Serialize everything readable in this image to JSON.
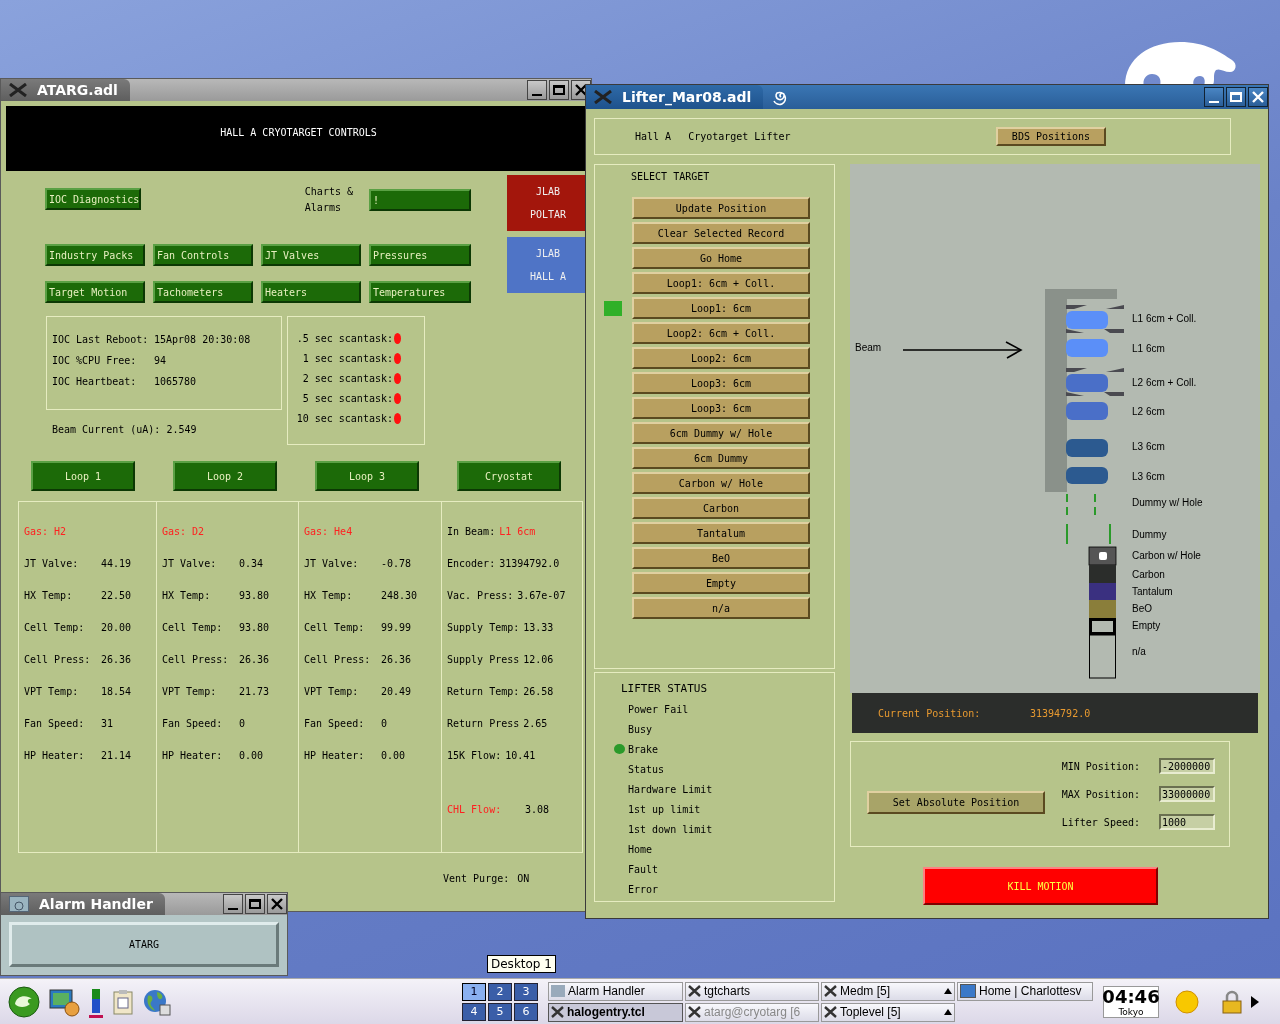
{
  "atarg_window": {
    "title": "ATARG.adl",
    "banner": "HALL A CRYOTARGET CONTROLS",
    "diagnostics_button": "IOC Diagnostics",
    "charts_label": [
      "Charts &",
      "Alarms"
    ],
    "charts_button": "!",
    "site_buttons": [
      {
        "lines": [
          "JLAB",
          "POLTAR"
        ],
        "color": "#a3160c"
      },
      {
        "lines": [
          "JLAB",
          "HALL A"
        ],
        "color": "#4f74c6"
      }
    ],
    "menu_buttons": [
      "Industry Packs",
      "Fan Controls",
      "JT Valves",
      "Pressures",
      "Target Motion",
      "Tachometers",
      "Heaters",
      "Temperatures"
    ],
    "ioc_info": [
      {
        "label": "IOC Last Reboot:",
        "value": "15Apr08 20:30:08"
      },
      {
        "label": "IOC %CPU Free:",
        "value": "94"
      },
      {
        "label": "IOC Heartbeat:",
        "value": "1065780"
      }
    ],
    "beam_current": {
      "label": "Beam Current (uA):",
      "value": "2.549"
    },
    "scantasks": [
      {
        "label": ".5 sec scantask:",
        "alarm": true
      },
      {
        "label": "1 sec scantask:",
        "alarm": true
      },
      {
        "label": "2 sec scantask:",
        "alarm": true
      },
      {
        "label": "5 sec scantask:",
        "alarm": true
      },
      {
        "label": "10 sec scantask:",
        "alarm": true
      }
    ],
    "loop_buttons": [
      "Loop 1",
      "Loop 2",
      "Loop 3",
      "Cryostat"
    ],
    "loops": [
      {
        "gas": "Gas: H2",
        "rows": [
          {
            "label": "JT Valve:",
            "value": "44.19"
          },
          {
            "label": "HX Temp:",
            "value": "22.50"
          },
          {
            "label": "Cell Temp:",
            "value": "20.00"
          },
          {
            "label": "Cell Press:",
            "value": "26.36"
          },
          {
            "label": "VPT Temp:",
            "value": "18.54"
          },
          {
            "label": "Fan Speed:",
            "value": "31"
          },
          {
            "label": "HP Heater:",
            "value": "21.14"
          }
        ]
      },
      {
        "gas": "Gas: D2",
        "rows": [
          {
            "label": "JT Valve:",
            "value": "0.34"
          },
          {
            "label": "HX Temp:",
            "value": "93.80"
          },
          {
            "label": "Cell Temp:",
            "value": "93.80"
          },
          {
            "label": "Cell Press:",
            "value": "26.36"
          },
          {
            "label": "VPT Temp:",
            "value": "21.73"
          },
          {
            "label": "Fan Speed:",
            "value": "0"
          },
          {
            "label": "HP Heater:",
            "value": "0.00"
          }
        ]
      },
      {
        "gas": "Gas: He4",
        "rows": [
          {
            "label": "JT Valve:",
            "value": "-0.78"
          },
          {
            "label": "HX Temp:",
            "value": "248.30"
          },
          {
            "label": "Cell Temp:",
            "value": "99.99"
          },
          {
            "label": "Cell Press:",
            "value": "26.36"
          },
          {
            "label": "VPT Temp:",
            "value": "20.49"
          },
          {
            "label": "Fan Speed:",
            "value": "0"
          },
          {
            "label": "HP Heater:",
            "value": "0.00"
          }
        ]
      }
    ],
    "cryostat": {
      "in_beam": {
        "label": "In Beam:",
        "value": "L1 6cm"
      },
      "rows": [
        {
          "label": "Encoder:",
          "value": "31394792.0"
        },
        {
          "label": "Vac. Press:",
          "value": "3.67e-07"
        },
        {
          "label": "Supply Temp:",
          "value": "13.33"
        },
        {
          "label": "Supply Press",
          "value": "12.06"
        },
        {
          "label": "Return Temp:",
          "value": "26.58"
        },
        {
          "label": "Return Press",
          "value": "2.65"
        },
        {
          "label": "15K Flow:",
          "value": "10.41"
        }
      ],
      "chl_flow": {
        "label": "CHL Flow:",
        "value": "3.08"
      }
    },
    "vent_purge": {
      "label": "Vent Purge:",
      "value": "ON"
    }
  },
  "lifter_window": {
    "title": "Lifter_Mar08.adl",
    "header": {
      "site": "Hall A",
      "name": "Cryotarget Lifter",
      "button": "BDS Positions"
    },
    "select_target": {
      "title": "SELECT TARGET",
      "buttons": [
        {
          "label": "Update Position",
          "selected": false
        },
        {
          "label": "Clear Selected Record",
          "selected": false
        },
        {
          "label": "Go Home",
          "selected": false
        },
        {
          "label": "Loop1: 6cm + Coll.",
          "selected": false
        },
        {
          "label": "Loop1: 6cm",
          "selected": true
        },
        {
          "label": "Loop2: 6cm + Coll.",
          "selected": false
        },
        {
          "label": "Loop2: 6cm",
          "selected": false
        },
        {
          "label": "Loop3: 6cm",
          "selected": false
        },
        {
          "label": "Loop3: 6cm",
          "selected": false
        },
        {
          "label": "6cm Dummy w/ Hole",
          "selected": false
        },
        {
          "label": "6cm Dummy",
          "selected": false
        },
        {
          "label": "Carbon w/ Hole",
          "selected": false
        },
        {
          "label": "Carbon",
          "selected": false
        },
        {
          "label": "Tantalum",
          "selected": false
        },
        {
          "label": "BeO",
          "selected": false
        },
        {
          "label": "Empty",
          "selected": false
        },
        {
          "label": "n/a",
          "selected": false
        }
      ]
    },
    "diagram": {
      "beam_label": "Beam",
      "targets": [
        {
          "label": "L1 6cm + Coll.",
          "kind": "collimated_cell",
          "color": "#5b8ff8"
        },
        {
          "label": "L1 6cm",
          "kind": "cell",
          "color": "#5b8ff8"
        },
        {
          "label": "L2 6cm + Coll.",
          "kind": "collimated_cell",
          "color": "#4a6fc8"
        },
        {
          "label": "L2 6cm",
          "kind": "cell",
          "color": "#4a6fc8"
        },
        {
          "label": "L3 6cm",
          "kind": "cell",
          "color": "#2c5a90"
        },
        {
          "label": "L3 6cm",
          "kind": "cell",
          "color": "#2c5a90"
        },
        {
          "label": "Dummy w/ Hole",
          "kind": "dummy_hole",
          "color": "#2a9a2a"
        },
        {
          "label": "Dummy",
          "kind": "dummy",
          "color": "#2a9a2a"
        },
        {
          "label": "Carbon w/ Hole",
          "kind": "solid_hole",
          "color": "#555555"
        },
        {
          "label": "Carbon",
          "kind": "solid",
          "color": "#2b2d2b"
        },
        {
          "label": "Tantalum",
          "kind": "solid",
          "color": "#3a3080"
        },
        {
          "label": "BeO",
          "kind": "solid",
          "color": "#8a7e3a"
        },
        {
          "label": "Empty",
          "kind": "empty",
          "color": "#000000"
        },
        {
          "label": "n/a",
          "kind": "none",
          "color": "#000000"
        }
      ]
    },
    "current_position": {
      "label": "Current Position:",
      "value": "31394792.0"
    },
    "settings": {
      "button": "Set Absolute Position",
      "fields": [
        {
          "label": "MIN Position:",
          "value": "-2000000"
        },
        {
          "label": "MAX Position:",
          "value": "33000000"
        },
        {
          "label": "Lifter Speed:",
          "value": "1000"
        }
      ]
    },
    "kill_button": "KILL MOTION",
    "status": {
      "title": "LIFTER STATUS",
      "items": [
        {
          "label": "Power Fail",
          "on": false
        },
        {
          "label": "Busy",
          "on": false
        },
        {
          "label": "Brake",
          "on": true
        },
        {
          "label": "Status",
          "on": false
        },
        {
          "label": "Hardware Limit",
          "on": false
        },
        {
          "label": "1st up limit",
          "on": false
        },
        {
          "label": "1st down limit",
          "on": false
        },
        {
          "label": "Home",
          "on": false
        },
        {
          "label": "Fault",
          "on": false
        },
        {
          "label": "Error",
          "on": false
        }
      ]
    }
  },
  "alarm_window": {
    "title": "Alarm Handler",
    "button": "ATARG"
  },
  "tooltip": "Desktop 1",
  "taskbar": {
    "pager": [
      {
        "label": "1",
        "selected": true
      },
      {
        "label": "2",
        "selected": false
      },
      {
        "label": "3",
        "selected": false
      },
      {
        "label": "4",
        "selected": false
      },
      {
        "label": "5",
        "selected": false
      },
      {
        "label": "6",
        "selected": false
      }
    ],
    "tasks": [
      {
        "label": "Alarm Handler",
        "kind": "alarm",
        "selected": false,
        "dimmed": false,
        "grouped": false
      },
      {
        "label": "tgtcharts",
        "kind": "x11",
        "selected": false,
        "dimmed": false,
        "grouped": false
      },
      {
        "label": "Medm [5]",
        "kind": "x11",
        "selected": false,
        "dimmed": false,
        "grouped": true
      },
      {
        "label": "Home | Charlottesv",
        "kind": "browser",
        "selected": false,
        "dimmed": false,
        "grouped": false
      },
      {
        "label": "halogentry.tcl",
        "kind": "x11",
        "selected": true,
        "dimmed": false,
        "grouped": false
      },
      {
        "label": "atarg@cryotarg [6",
        "kind": "x11",
        "selected": false,
        "dimmed": true,
        "grouped": false
      },
      {
        "label": "Toplevel [5]",
        "kind": "x11",
        "selected": false,
        "dimmed": false,
        "grouped": true
      }
    ],
    "clock": {
      "time": "04:46",
      "city": "Tokyo"
    }
  }
}
